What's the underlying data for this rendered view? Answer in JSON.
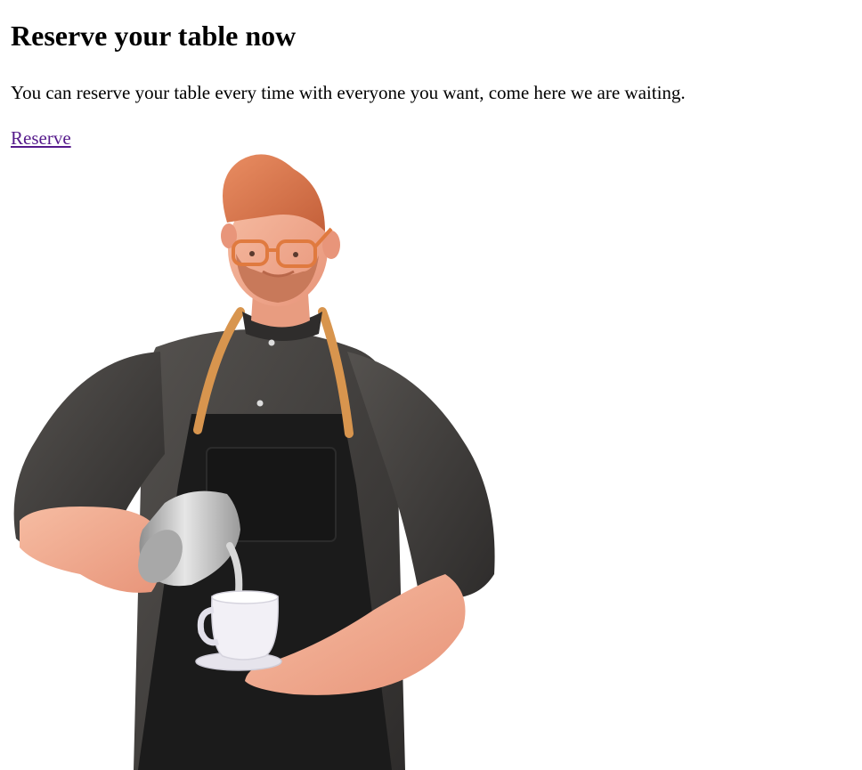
{
  "heading": "Reserve your table now",
  "description": "You can reserve your table every time with everyone you want, come here we are waiting.",
  "reserve_link": "Reserve",
  "illustration": {
    "subject": "barista-pouring-coffee",
    "colors": {
      "hair": "#d9734a",
      "skin": "#f1a98a",
      "shirt": "#3f3d3b",
      "apron": "#1c1c1c",
      "strap": "#d8954e",
      "glasses": "#e07a3f",
      "beard": "#c8795a",
      "pitcher": "#b9b9b9",
      "cup": "#f2f0f6"
    }
  }
}
